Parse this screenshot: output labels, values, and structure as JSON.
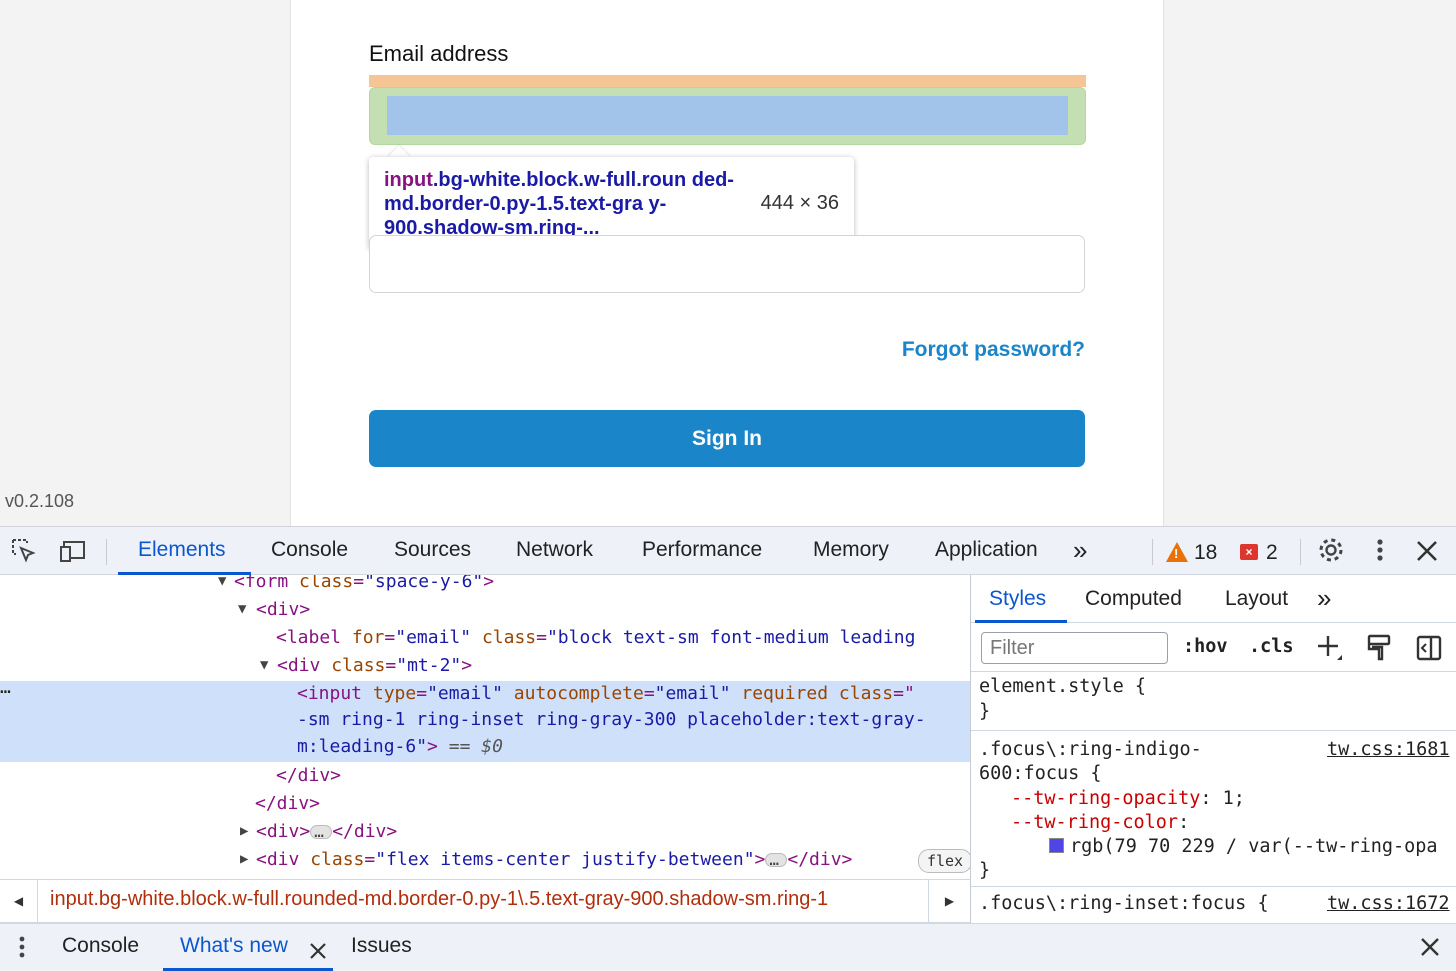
{
  "page": {
    "email_label": "Email address",
    "tooltip_tag": "input",
    "tooltip_selector": ".bg-white.block.w-full.roun ded-md.border-0.py-1.5.text-gra y-900.shadow-sm.ring-...",
    "tooltip_size": "444 × 36",
    "forgot_password": "Forgot password?",
    "sign_in": "Sign In",
    "version": "v0.2.108"
  },
  "devtools": {
    "tabs": [
      "Elements",
      "Console",
      "Sources",
      "Network",
      "Performance",
      "Memory",
      "Application"
    ],
    "active_tab": "Elements",
    "more": "»",
    "warnings": "18",
    "errors": "2",
    "dom_lines": {
      "form_tag": "<form",
      "form_attr": "class",
      "form_val": "\"space-y-6\"",
      "div_open": "<div>",
      "label_tag": "<label",
      "label_for": "for",
      "label_for_val": "\"email\"",
      "label_class": "class",
      "label_class_val": "\"block text-sm font-medium leading",
      "mt2_tag": "<div",
      "mt2_attr": "class",
      "mt2_val": "\"mt-2\"",
      "input_tag": "<input",
      "input_type": "type",
      "input_type_val": "\"email\"",
      "input_auto": "autocomplete",
      "input_auto_val": "\"email\"",
      "input_req": "required",
      "input_class": "class",
      "input_line2": "-sm ring-1 ring-inset ring-gray-300 placeholder:text-gray-",
      "input_line3": "m:leading-6\"",
      "input_eq": "== $0",
      "div_close1": "</div>",
      "div_close2": "</div>",
      "collapsed_div": "<div>",
      "collapsed_div_close": "</div>",
      "flex_div_tag": "<div",
      "flex_div_attr": "class",
      "flex_div_val": "\"flex items-center justify-between\"",
      "flex_div_close": "</div>",
      "flex_badge": "flex"
    },
    "breadcrumb": "input.bg-white.block.w-full.rounded-md.border-0.py-1\\.5.text-gray-900.shadow-sm.ring-1",
    "styles": {
      "tabs": [
        "Styles",
        "Computed",
        "Layout"
      ],
      "filter_placeholder": "Filter",
      "hov": ":hov",
      "cls": ".cls",
      "element_style": "element.style {",
      "close_brace": "}",
      "rule1_sel_a": ".focus\\:ring-indigo-",
      "rule1_sel_b": "600:focus {",
      "rule1_src": "tw.css:1681",
      "rule1_prop1": "--tw-ring-opacity",
      "rule1_val1": ": 1;",
      "rule1_prop2": "--tw-ring-color",
      "rule1_val2": ":",
      "rule1_color": "rgb(79 70 229 / var(--tw-ring-opa",
      "rule2_sel": ".focus\\:ring-inset:focus {",
      "rule2_src": "tw.css:1672"
    },
    "drawer_tabs": [
      "Console",
      "What's new",
      "Issues"
    ],
    "drawer_active": "What's new"
  },
  "colors": {
    "accent": "#1a86c9",
    "devtools_blue": "#0b57d0",
    "margin_highlight": "#f6c595",
    "border_highlight": "#c4dfb2",
    "content_highlight": "#a3c4ea",
    "ring_color": "#4f46e5"
  }
}
